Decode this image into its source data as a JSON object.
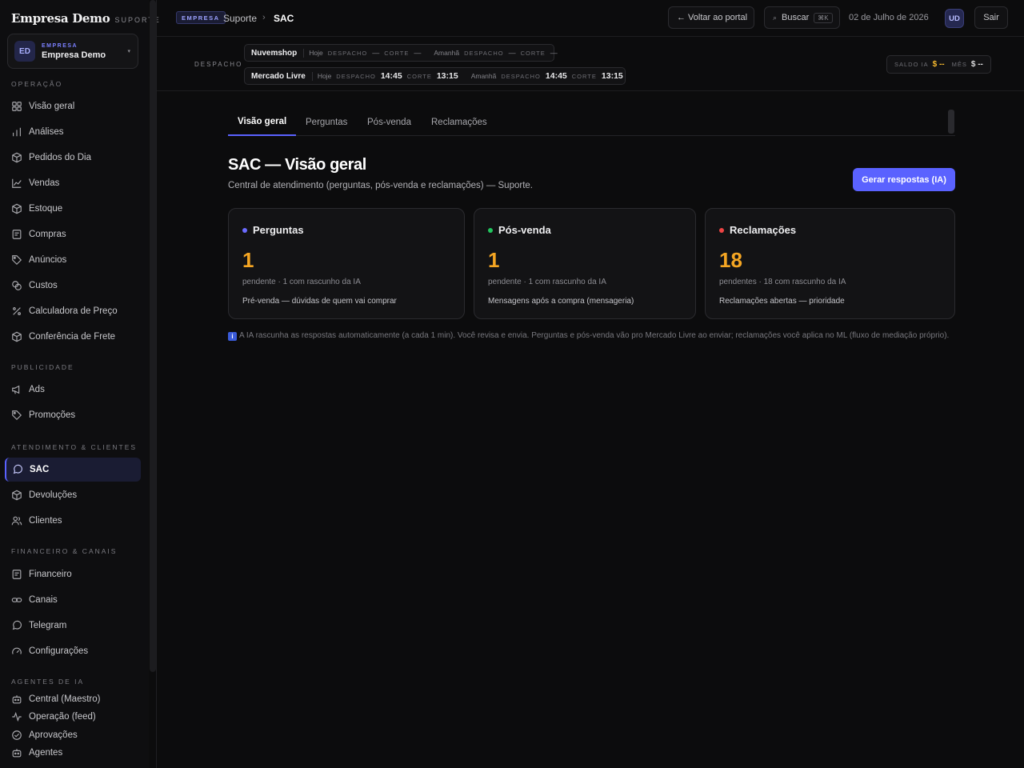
{
  "brand": {
    "name": "Empresa Demo",
    "tag": "SUPORTE"
  },
  "company": {
    "initials": "ED",
    "label": "EMPRESA",
    "name": "Empresa Demo"
  },
  "sidebar": {
    "sections": {
      "operacao": "OPERAÇÃO",
      "publicidade": "PUBLICIDADE",
      "atendimento": "ATENDIMENTO & CLIENTES",
      "financeiro": "FINANCEIRO & CANAIS",
      "agentes": "AGENTES DE IA"
    },
    "items": {
      "visao_geral": "Visão geral",
      "analises": "Análises",
      "pedidos": "Pedidos do Dia",
      "vendas": "Vendas",
      "estoque": "Estoque",
      "compras": "Compras",
      "anuncios": "Anúncios",
      "custos": "Custos",
      "calculadora": "Calculadora de Preço",
      "conferencia": "Conferência de Frete",
      "ads": "Ads",
      "promocoes": "Promoções",
      "sac": "SAC",
      "devolucoes": "Devoluções",
      "clientes": "Clientes",
      "financeiro": "Financeiro",
      "canais": "Canais",
      "telegram": "Telegram",
      "configuracoes": "Configurações",
      "central": "Central (Maestro)",
      "operacao_feed": "Operação (feed)",
      "aprovacoes": "Aprovações",
      "agentes": "Agentes"
    }
  },
  "topbar": {
    "badge": "EMPRESA",
    "crumb1": "Suporte",
    "crumb_sep": "›",
    "crumb2": "SAC",
    "back": "← Voltar ao portal",
    "search": "Buscar",
    "search_kbd": "⌘K",
    "date": "02 de Julho de 2026",
    "user_initials": "UD",
    "logout": "Sair"
  },
  "despacho": {
    "label": "DESPACHO",
    "rows": [
      {
        "store": "Nuvemshop",
        "today": "Hoje",
        "dispatch_label": "DESPACHO",
        "dispatch_today": "—",
        "cut_label": "CORTE",
        "cut_today": "—",
        "tomorrow": "Amanhã",
        "dispatch_tomorrow": "—",
        "cut_tomorrow": "—"
      },
      {
        "store": "Mercado Livre",
        "today": "Hoje",
        "dispatch_label": "DESPACHO",
        "dispatch_today": "14:45",
        "cut_label": "CORTE",
        "cut_today": "13:15",
        "tomorrow": "Amanhã",
        "dispatch_tomorrow": "14:45",
        "cut_tomorrow": "13:15"
      }
    ],
    "saldo_label": "SALDO IA",
    "saldo_value": "$ --",
    "mes_label": "MÊS",
    "mes_value": "$ --"
  },
  "tabs": [
    "Visão geral",
    "Perguntas",
    "Pós-venda",
    "Reclamações"
  ],
  "page": {
    "title": "SAC — Visão geral",
    "subtitle": "Central de atendimento (perguntas, pós-venda e reclamações) — Suporte.",
    "action": "Gerar respostas (IA)"
  },
  "cards": [
    {
      "title": "Perguntas",
      "dot_color": "#6b6bff",
      "count": "1",
      "meta": "pendente · 1 com rascunho da IA",
      "desc": "Pré-venda — dúvidas de quem vai comprar"
    },
    {
      "title": "Pós-venda",
      "dot_color": "#22c55e",
      "count": "1",
      "meta": "pendente · 1 com rascunho da IA",
      "desc": "Mensagens após a compra (mensageria)"
    },
    {
      "title": "Reclamações",
      "dot_color": "#ef4444",
      "count": "18",
      "meta": "pendentes · 18 com rascunho da IA",
      "desc": "Reclamações abertas — prioridade"
    }
  ],
  "info": {
    "icon": "i",
    "text": "A IA rascunha as respostas automaticamente (a cada 1 min). Você revisa e envia. Perguntas e pós-venda vão pro Mercado Livre ao enviar; reclamações você aplica no ML (fluxo de mediação próprio)."
  },
  "colors": {
    "accent": "#5a62ff",
    "highlight": "#f5a623",
    "background": "#0c0c0d"
  }
}
